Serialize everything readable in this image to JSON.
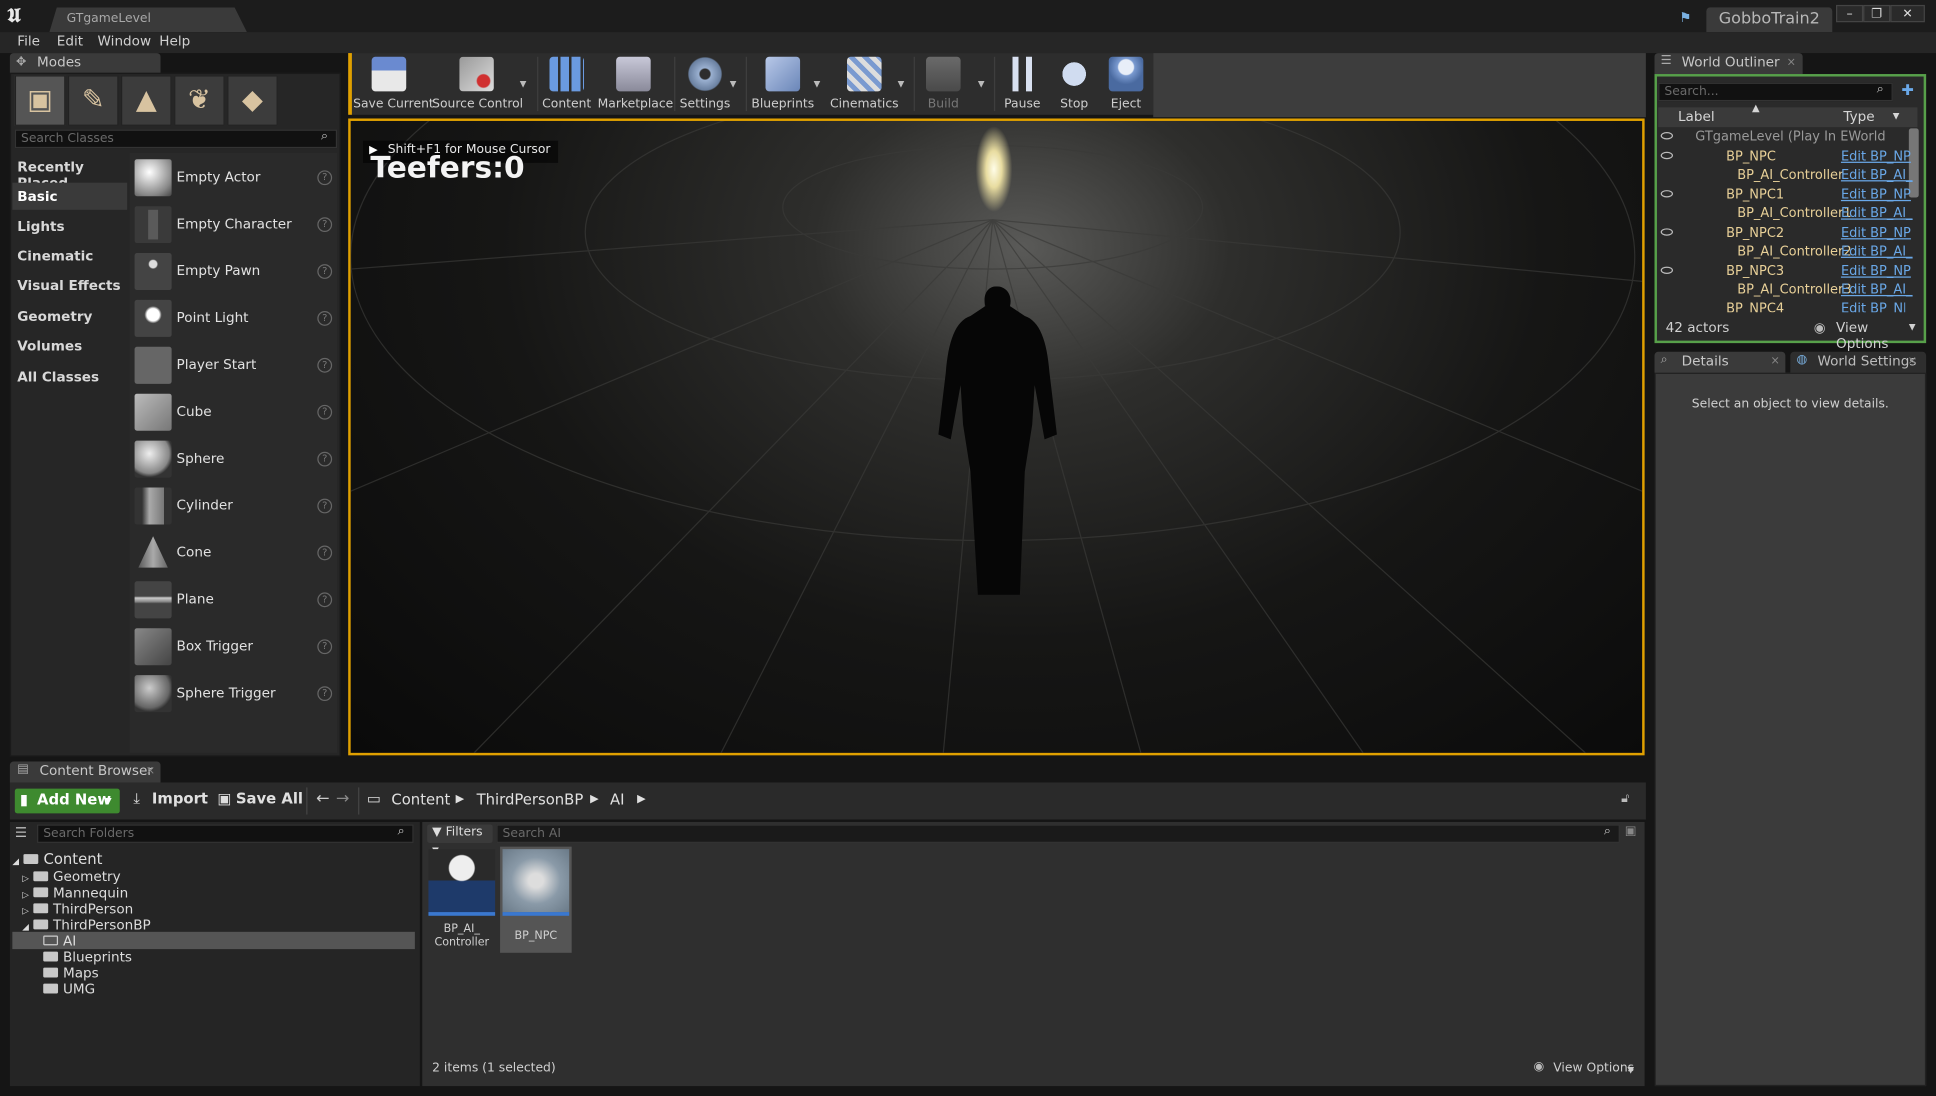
{
  "window": {
    "tab_title": "GTgameLevel",
    "project_name": "GobboTrain2",
    "controls": [
      "–",
      "❐",
      "✕"
    ]
  },
  "menu": [
    "File",
    "Edit",
    "Window",
    "Help"
  ],
  "modes": {
    "tab_label": "Modes",
    "search_placeholder": "Search Classes",
    "categories": [
      "Recently Placed",
      "Basic",
      "Lights",
      "Cinematic",
      "Visual Effects",
      "Geometry",
      "Volumes",
      "All Classes"
    ],
    "active_category": "Basic",
    "items": [
      "Empty Actor",
      "Empty Character",
      "Empty Pawn",
      "Point Light",
      "Player Start",
      "Cube",
      "Sphere",
      "Cylinder",
      "Cone",
      "Plane",
      "Box Trigger",
      "Sphere Trigger"
    ]
  },
  "toolbar": {
    "save_current": "Save Current",
    "source_control": "Source Control",
    "content": "Content",
    "marketplace": "Marketplace",
    "settings": "Settings",
    "blueprints": "Blueprints",
    "cinematics": "Cinematics",
    "build": "Build",
    "pause": "Pause",
    "stop": "Stop",
    "eject": "Eject"
  },
  "viewport": {
    "hint": "Shift+F1 for Mouse Cursor",
    "overlay_text": "Teefers:0"
  },
  "outliner": {
    "tab_label": "World Outliner",
    "search_placeholder": "Search...",
    "col_label": "Label",
    "col_type": "Type",
    "rows": [
      {
        "label": "GTgameLevel (Play In EWorld",
        "type": ""
      },
      {
        "label": "BP_NPC",
        "type": "Edit BP_NP"
      },
      {
        "label": "BP_AI_Controller",
        "type": "Edit BP_AI_"
      },
      {
        "label": "BP_NPC1",
        "type": "Edit BP_NP"
      },
      {
        "label": "BP_AI_Controller1",
        "type": "Edit BP_AI_"
      },
      {
        "label": "BP_NPC2",
        "type": "Edit BP_NP"
      },
      {
        "label": "BP_AI_Controller2",
        "type": "Edit BP_AI_"
      },
      {
        "label": "BP_NPC3",
        "type": "Edit BP_NP"
      },
      {
        "label": "BP_AI_Controller3",
        "type": "Edit BP_AI_"
      },
      {
        "label": "BP_NPC4",
        "type": "Edit BP_NP"
      }
    ],
    "actor_count": "42 actors",
    "view_options": "View Options"
  },
  "details": {
    "tab_label": "Details",
    "world_settings_label": "World Settings",
    "empty_text": "Select an object to view details."
  },
  "content_browser": {
    "tab_label": "Content Browser",
    "add_new": "Add New",
    "import": "Import",
    "save_all": "Save All",
    "breadcrumbs": [
      "Content",
      "ThirdPersonBP",
      "AI"
    ],
    "search_folders_placeholder": "Search Folders",
    "tree_root": "Content",
    "tree": [
      "Geometry",
      "Mannequin",
      "ThirdPerson",
      "ThirdPersonBP",
      "AI",
      "Blueprints",
      "Maps",
      "UMG"
    ],
    "filters": "Filters",
    "search_assets_placeholder": "Search AI",
    "assets": [
      {
        "line1": "BP_AI_",
        "line2": "Controller"
      },
      {
        "line1": "BP_NPC",
        "line2": ""
      }
    ],
    "status": "2 items (1 selected)",
    "view_options": "View Options"
  }
}
